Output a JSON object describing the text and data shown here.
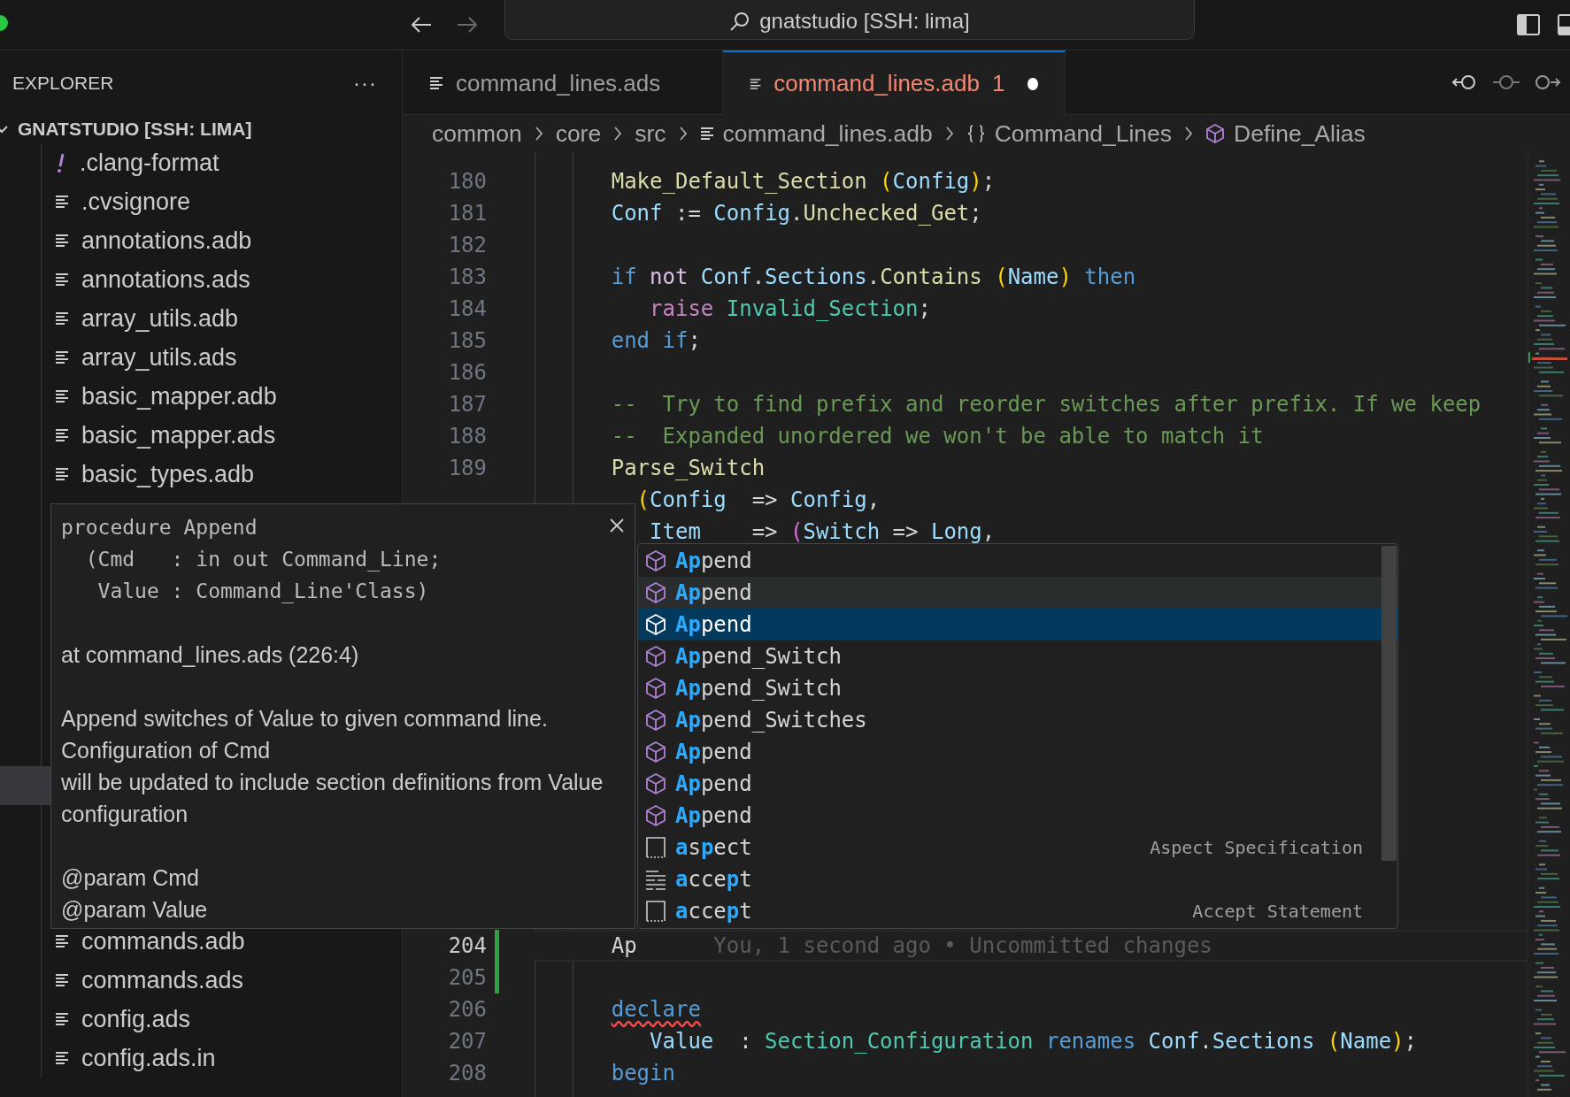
{
  "title_bar": {
    "title": "gnatstudio [SSH: lima]",
    "back_disabled": false,
    "forward_disabled": true
  },
  "sidebar": {
    "title": "EXPLORER",
    "more": "···",
    "root": "GNATSTUDIO [SSH: LIMA]",
    "files_top": [
      {
        "name": ".clang-format",
        "kind": "config"
      },
      {
        "name": ".cvsignore",
        "kind": "text"
      },
      {
        "name": "annotations.adb",
        "kind": "text"
      },
      {
        "name": "annotations.ads",
        "kind": "text"
      },
      {
        "name": "array_utils.adb",
        "kind": "text"
      },
      {
        "name": "array_utils.ads",
        "kind": "text"
      },
      {
        "name": "basic_mapper.adb",
        "kind": "text"
      },
      {
        "name": "basic_mapper.ads",
        "kind": "text"
      },
      {
        "name": "basic_types.adb",
        "kind": "text"
      }
    ],
    "files_bottom": [
      {
        "name": "commands.adb",
        "kind": "text"
      },
      {
        "name": "commands.ads",
        "kind": "text"
      },
      {
        "name": "config.ads",
        "kind": "text"
      },
      {
        "name": "config.ads.in",
        "kind": "text"
      }
    ]
  },
  "tabs": [
    {
      "label": "command_lines.ads",
      "selected": false,
      "dirty": false
    },
    {
      "label": "command_lines.adb",
      "selected": true,
      "dirty": true,
      "problems": "1"
    }
  ],
  "breadcrumbs": [
    {
      "label": "common",
      "kind": "folder"
    },
    {
      "label": "core",
      "kind": "folder"
    },
    {
      "label": "src",
      "kind": "folder"
    },
    {
      "label": "command_lines.adb",
      "kind": "file"
    },
    {
      "label": "Command_Lines",
      "kind": "namespace"
    },
    {
      "label": "Define_Alias",
      "kind": "symbol"
    }
  ],
  "editor": {
    "lines_top": [
      {
        "number": "180",
        "current": false,
        "changed": false,
        "tokens": [
          {
            "t": "Make_Default_Section",
            "kind": "func"
          },
          {
            "t": " (",
            "kind": "paren"
          },
          {
            "t": "Config",
            "kind": "var"
          },
          {
            "t": ")",
            "kind": "paren"
          },
          {
            "t": ";",
            "kind": "plain"
          }
        ]
      },
      {
        "number": "181",
        "current": false,
        "changed": false,
        "tokens": [
          {
            "t": "Conf",
            "kind": "var"
          },
          {
            "t": " := ",
            "kind": "plain"
          },
          {
            "t": "Config",
            "kind": "var"
          },
          {
            "t": ".",
            "kind": "plain"
          },
          {
            "t": "Unchecked_Get",
            "kind": "func"
          },
          {
            "t": ";",
            "kind": "plain"
          }
        ]
      },
      {
        "number": "182",
        "current": false,
        "changed": false
      },
      {
        "number": "183",
        "current": false,
        "changed": false,
        "tokens": [
          {
            "t": "if ",
            "kind": "keyword"
          },
          {
            "t": "not ",
            "kind": "operator"
          },
          {
            "t": "Conf",
            "kind": "var"
          },
          {
            "t": ".",
            "kind": "plain"
          },
          {
            "t": "Sections",
            "kind": "var"
          },
          {
            "t": ".",
            "kind": "plain"
          },
          {
            "t": "Contains",
            "kind": "func"
          },
          {
            "t": " (",
            "kind": "paren"
          },
          {
            "t": "Name",
            "kind": "var"
          },
          {
            "t": ") ",
            "kind": "paren"
          },
          {
            "t": "then",
            "kind": "keyword"
          }
        ]
      },
      {
        "number": "184",
        "current": false,
        "changed": false,
        "kind": "block",
        "tokens": [
          {
            "t": "raise ",
            "kind": "control"
          },
          {
            "t": "Invalid_Section",
            "kind": "type"
          },
          {
            "t": ";",
            "kind": "plain"
          }
        ]
      },
      {
        "number": "185",
        "current": false,
        "changed": false,
        "tokens": [
          {
            "t": "end ",
            "kind": "keyword"
          },
          {
            "t": "if",
            "kind": "keyword"
          },
          {
            "t": ";",
            "kind": "plain"
          }
        ]
      },
      {
        "number": "186",
        "current": false,
        "changed": false
      },
      {
        "number": "187",
        "current": false,
        "changed": false,
        "tokens": [
          {
            "t": "--  Try to find prefix and reorder switches after prefix. If we keep",
            "kind": "comment"
          }
        ]
      },
      {
        "number": "188",
        "current": false,
        "changed": false,
        "tokens": [
          {
            "t": "--  Expanded unordered we won't be able to match it",
            "kind": "comment"
          }
        ]
      },
      {
        "number": "189",
        "current": false,
        "changed": false,
        "tokens": [
          {
            "t": "Parse_Switch",
            "kind": "func"
          }
        ]
      },
      {
        "current": false,
        "changed": false,
        "kind": "paren",
        "tokens": [
          {
            "t": "(",
            "kind": "paren"
          },
          {
            "t": "Config",
            "kind": "var"
          },
          {
            "t": "  => ",
            "kind": "plain"
          },
          {
            "t": "Config",
            "kind": "var"
          },
          {
            "t": ",",
            "kind": "plain"
          }
        ]
      },
      {
        "current": false,
        "kind": "block",
        "tokens": [
          {
            "t": "Item",
            "kind": "var"
          },
          {
            "t": "    => ",
            "kind": "plain"
          },
          {
            "t": "(",
            "kind": "paren2"
          },
          {
            "t": "Switch",
            "kind": "var"
          },
          {
            "t": " => ",
            "kind": "plain"
          },
          {
            "t": "Long",
            "kind": "var"
          },
          {
            "t": ",",
            "kind": "plain"
          }
        ]
      }
    ],
    "lines_bottom": [
      {
        "number": "204",
        "current": true,
        "changed": true,
        "tokens": [
          {
            "t": "Ap",
            "kind": "plain"
          }
        ],
        "blame": "You, 1 second ago • Uncommitted changes"
      },
      {
        "number": "205",
        "current": false,
        "changed": true
      },
      {
        "number": "206",
        "current": false,
        "changed": false,
        "tokens": [
          {
            "t": "declare",
            "kind": "error_keyword"
          }
        ]
      },
      {
        "number": "207",
        "current": false,
        "changed": false,
        "kind": "block",
        "tokens": [
          {
            "t": "Value",
            "kind": "var"
          },
          {
            "t": "  : ",
            "kind": "plain"
          },
          {
            "t": "Section_Configuration ",
            "kind": "type"
          },
          {
            "t": "renames ",
            "kind": "keyword"
          },
          {
            "t": "Conf",
            "kind": "var"
          },
          {
            "t": ".",
            "kind": "plain"
          },
          {
            "t": "Sections",
            "kind": "var"
          },
          {
            "t": " (",
            "kind": "paren"
          },
          {
            "t": "Name",
            "kind": "var"
          },
          {
            "t": ")",
            "kind": "paren"
          },
          {
            "t": ";",
            "kind": "plain"
          }
        ]
      },
      {
        "number": "208",
        "current": false,
        "changed": false,
        "tokens": [
          {
            "t": "begin",
            "kind": "keyword"
          }
        ]
      }
    ]
  },
  "hover": {
    "signature": [
      "procedure Append",
      "  (Cmd   : in out Command_Line;",
      "   Value : Command_Line'Class)"
    ],
    "location": "at command_lines.ads (226:4)",
    "description": [
      "Append switches of Value to given command line.",
      "Configuration of Cmd",
      "will be updated to include section definitions from Value",
      "configuration"
    ],
    "params": [
      "@param Cmd",
      "@param Value"
    ]
  },
  "suggestions": [
    {
      "kind": "method",
      "selected": false,
      "hovered": false,
      "parts": [
        {
          "t": "Ap",
          "match": true
        },
        {
          "t": "pend",
          "match": false
        }
      ]
    },
    {
      "kind": "method",
      "selected": false,
      "hovered": true,
      "parts": [
        {
          "t": "Ap",
          "match": true
        },
        {
          "t": "pend",
          "match": false
        }
      ]
    },
    {
      "kind": "method",
      "selected": true,
      "hovered": false,
      "parts": [
        {
          "t": "Ap",
          "match": true
        },
        {
          "t": "pend",
          "match": false
        }
      ]
    },
    {
      "kind": "method",
      "selected": false,
      "hovered": false,
      "parts": [
        {
          "t": "Ap",
          "match": true
        },
        {
          "t": "pend_Switch",
          "match": false
        }
      ]
    },
    {
      "kind": "method",
      "selected": false,
      "hovered": false,
      "parts": [
        {
          "t": "Ap",
          "match": true
        },
        {
          "t": "pend_Switch",
          "match": false
        }
      ]
    },
    {
      "kind": "method",
      "selected": false,
      "hovered": false,
      "parts": [
        {
          "t": "Ap",
          "match": true
        },
        {
          "t": "pend_Switches",
          "match": false
        }
      ]
    },
    {
      "kind": "method",
      "selected": false,
      "hovered": false,
      "parts": [
        {
          "t": "Ap",
          "match": true
        },
        {
          "t": "pend",
          "match": false
        }
      ]
    },
    {
      "kind": "method",
      "selected": false,
      "hovered": false,
      "parts": [
        {
          "t": "Ap",
          "match": true
        },
        {
          "t": "pend",
          "match": false
        }
      ]
    },
    {
      "kind": "method",
      "selected": false,
      "hovered": false,
      "parts": [
        {
          "t": "Ap",
          "match": true
        },
        {
          "t": "pend",
          "match": false
        }
      ]
    },
    {
      "kind": "snippet",
      "selected": false,
      "hovered": false,
      "parts": [
        {
          "t": "a",
          "match": true
        },
        {
          "t": "s",
          "match": false
        },
        {
          "t": "p",
          "match": true
        },
        {
          "t": "ect",
          "match": false
        }
      ],
      "detail": "Aspect Specification"
    },
    {
      "kind": "keyword",
      "selected": false,
      "hovered": false,
      "parts": [
        {
          "t": "a",
          "match": true
        },
        {
          "t": "cce",
          "match": false
        },
        {
          "t": "p",
          "match": true
        },
        {
          "t": "t",
          "match": false
        }
      ]
    },
    {
      "kind": "snippet",
      "selected": false,
      "hovered": false,
      "parts": [
        {
          "t": "a",
          "match": true
        },
        {
          "t": "cce",
          "match": false
        },
        {
          "t": "p",
          "match": true
        },
        {
          "t": "t",
          "match": false
        }
      ],
      "detail": "Accept Statement"
    }
  ]
}
